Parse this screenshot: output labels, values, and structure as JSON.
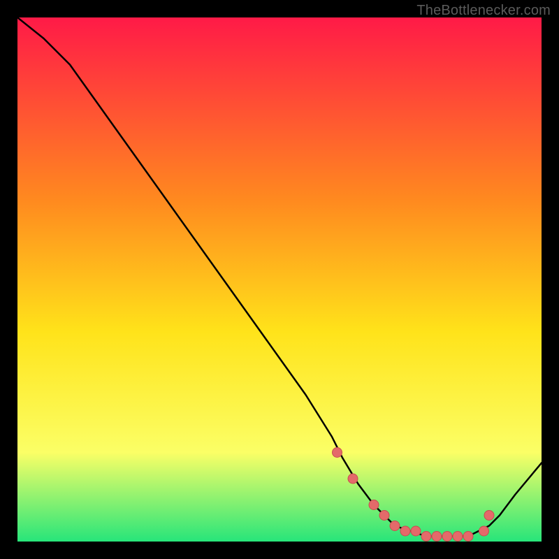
{
  "watermark": "TheBottlenecker.com",
  "colors": {
    "frame": "#000000",
    "gradient_top": "#ff1a47",
    "gradient_mid_upper": "#ff8a1f",
    "gradient_mid": "#ffe31a",
    "gradient_mid_lower": "#fbff66",
    "gradient_bottom": "#27e57a",
    "curve": "#000000",
    "dot_fill": "#e46a6a",
    "dot_stroke": "#c74f4f"
  },
  "chart_data": {
    "type": "line",
    "title": "",
    "xlabel": "",
    "ylabel": "",
    "xlim": [
      0,
      100
    ],
    "ylim": [
      0,
      100
    ],
    "grid": false,
    "legend": false,
    "series": [
      {
        "name": "bottleneck-curve",
        "x": [
          0,
          5,
          10,
          15,
          20,
          25,
          30,
          35,
          40,
          45,
          50,
          55,
          60,
          62,
          65,
          68,
          70,
          72,
          75,
          78,
          80,
          82,
          84,
          86,
          88,
          90,
          92,
          95,
          100
        ],
        "y": [
          100,
          96,
          91,
          84,
          77,
          70,
          63,
          56,
          49,
          42,
          35,
          28,
          20,
          16,
          11,
          7,
          5,
          3,
          2,
          1,
          1,
          1,
          1,
          1,
          2,
          3,
          5,
          9,
          15
        ]
      },
      {
        "name": "optimal-dots",
        "x": [
          61,
          64,
          68,
          70,
          72,
          74,
          76,
          78,
          80,
          82,
          84,
          86,
          89,
          90
        ],
        "y": [
          17,
          12,
          7,
          5,
          3,
          2,
          2,
          1,
          1,
          1,
          1,
          1,
          2,
          5
        ]
      }
    ],
    "annotations": []
  }
}
